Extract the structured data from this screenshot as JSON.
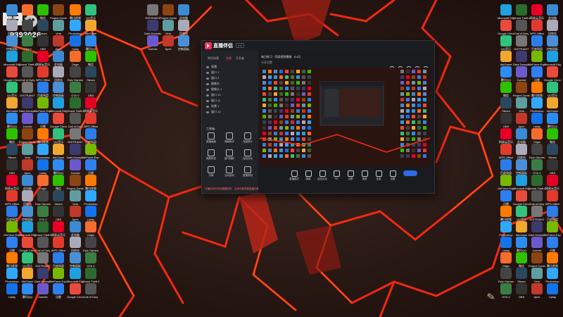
{
  "overlay": {
    "number": "9393026"
  },
  "app": {
    "title": "直播伴侣",
    "version": "4.8",
    "left_tabs": [
      "常用场景",
      "场景",
      "开发者"
    ],
    "left_active_tab": 1,
    "scenes": [
      "直播",
      "窗口 1",
      "窗口 2",
      "摄像头",
      "摄像头 1",
      "窗口 14",
      "窗口 11",
      "场景 1",
      "窗口 12"
    ],
    "tools_header": "工具箱",
    "tools": [
      "直播画面",
      "弹幕助手",
      "流量统计",
      "美颜特效",
      "窗口捕获",
      "连线互动",
      "字幕",
      "互动游戏",
      "直播录制"
    ],
    "footer": "开播后请勿关闭直播伴侣，否则可能导致直播中断",
    "right_title": "每日练习 · 同类视频播放 · 8.6万",
    "right_subtitle": "分享设置",
    "bottom": [
      "直播模式",
      "弹幕",
      "连线互动",
      "PK",
      "点歌",
      "清屏",
      "连麦",
      "设置"
    ]
  },
  "icons": [
    {
      "label": "此电脑",
      "color": "#3a8bd4"
    },
    {
      "label": "回收站",
      "color": "#aab"
    },
    {
      "label": "控制面板",
      "color": "#4a90d9"
    },
    {
      "label": "Microsoft Edge",
      "color": "#1fa1e0"
    },
    {
      "label": "Google Chrome",
      "color": "#e84b3c"
    },
    {
      "label": "QQ音乐",
      "color": "#31c27c"
    },
    {
      "label": "WeGame",
      "color": "#f0a830"
    },
    {
      "label": "腾讯QQ",
      "color": "#2d8cf0"
    },
    {
      "label": "微信",
      "color": "#2dc100"
    },
    {
      "label": "Steam",
      "color": "#2a475e"
    },
    {
      "label": "OBS",
      "color": "#333"
    },
    {
      "label": "网易云音乐",
      "color": "#e60026"
    },
    {
      "label": "WPS Office",
      "color": "#e23b2e"
    },
    {
      "label": "百度网盘",
      "color": "#2b7de9"
    },
    {
      "label": "GeForce Experience",
      "color": "#76b900"
    },
    {
      "label": "迅雷",
      "color": "#2e7ff0"
    },
    {
      "label": "腾讯视频",
      "color": "#ff7a00"
    },
    {
      "label": "Photoshop",
      "color": "#31a8ff"
    },
    {
      "label": "Uplay",
      "color": "#1273ea"
    },
    {
      "label": "Origin",
      "color": "#f56c2d"
    },
    {
      "label": "Epic Games",
      "color": "#444"
    },
    {
      "label": "GTA V",
      "color": "#3a7d44"
    },
    {
      "label": "Grand Theft Auto V",
      "color": "#2c6b2f"
    },
    {
      "label": "Call of Duty",
      "color": "#555"
    },
    {
      "label": "DISTRAINT",
      "color": "#777"
    },
    {
      "label": "Dark Deception",
      "color": "#3b3b6d"
    },
    {
      "label": "Zombie",
      "color": "#6a5acd"
    },
    {
      "label": "Project Zomboid",
      "color": "#8b4513"
    },
    {
      "label": "Vela",
      "color": "#5f9ea0"
    },
    {
      "label": "Apex",
      "color": "#c0392b"
    }
  ]
}
